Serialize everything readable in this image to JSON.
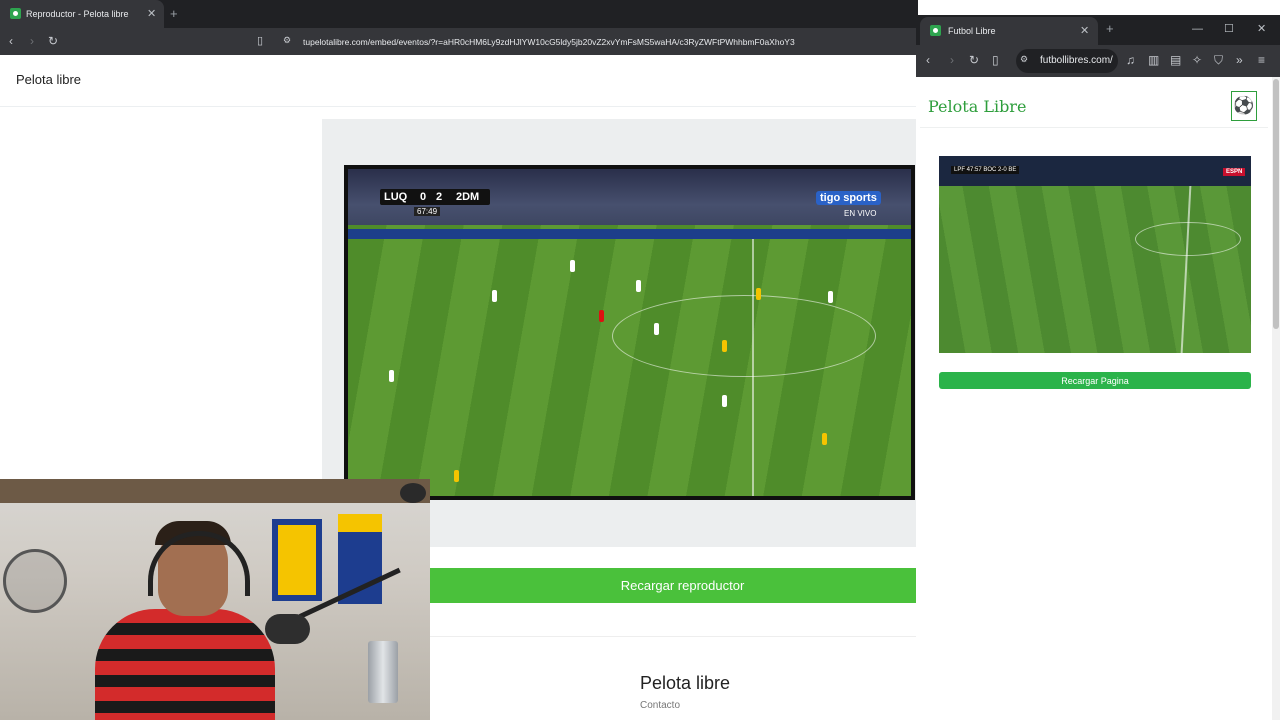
{
  "left_browser": {
    "tab_title": "Reproductor - Pelota libre",
    "url": "tupelotalibre.com/embed/eventos/?r=aHR0cHM6Ly9zdHJlYW10cG5ldy5jb20vZ2xvYmFsMS5waHA/c3RyZWFtPWhhbmF0aXhoY3",
    "page": {
      "brand": "Pelota libre",
      "reload_button": "Recargar reproductor",
      "footer_title": "Pelota libre",
      "footer_link": "Contacto"
    },
    "video": {
      "home_team": "LUQ",
      "home_score": "0",
      "away_score": "2",
      "away_team": "2DM",
      "clock": "67:49",
      "channel": "tigo sports",
      "live": "EN VIVO"
    }
  },
  "right_browser": {
    "tab_title": "Futbol Libre",
    "url": "futbollibres.com/",
    "page": {
      "brand": "Pelota Libre",
      "reload_button": "Recargar Pagina"
    },
    "thumbnail": {
      "scoreline": "LPF 47:57 BOC 2-0 BE",
      "channel": "ESPN"
    }
  },
  "colors": {
    "accent_green": "#4ac13b",
    "brand_green": "#2e9e3c",
    "browser_chrome": "#35363a"
  }
}
